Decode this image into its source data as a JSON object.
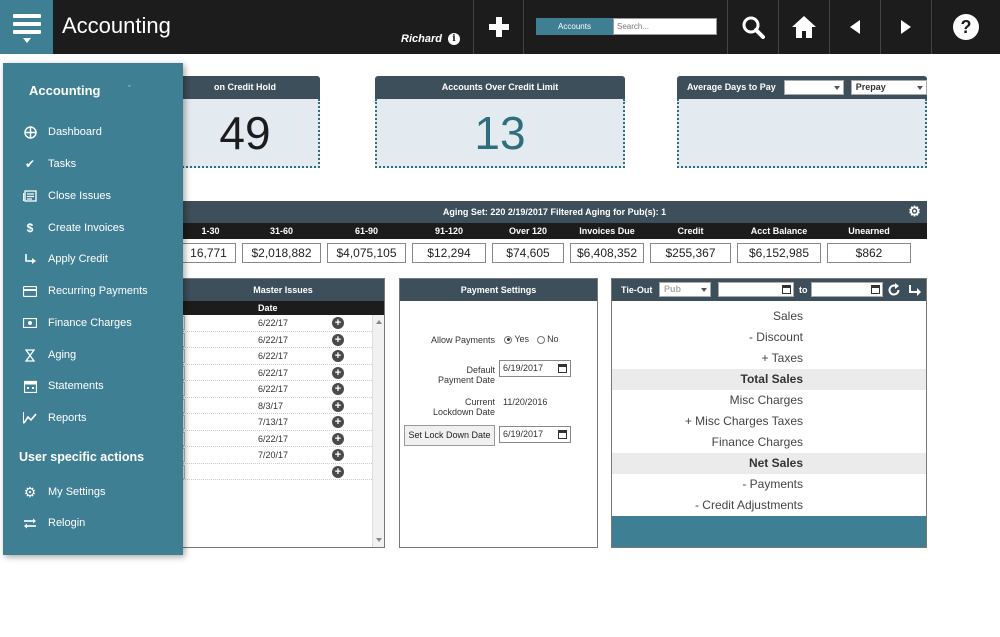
{
  "header": {
    "title": "Accounting",
    "user": "Richard",
    "search_scope": "Accounts",
    "search_placeholder": "Search..."
  },
  "cards": [
    {
      "title": "on Credit Hold",
      "value": "49"
    },
    {
      "title": "Accounts Over Credit Limit",
      "value": "13"
    },
    {
      "title": "Average Days to Pay",
      "select1": "",
      "select2": "Prepay"
    }
  ],
  "aging": {
    "title": "Aging Set:  220 2/19/2017 Filtered Aging for Pub(s): 1",
    "columns": [
      "1-30",
      "31-60",
      "61-90",
      "91-120",
      "Over 120",
      "Invoices Due",
      "Credit",
      "Acct Balance",
      "Unearned"
    ],
    "values": [
      "16,771",
      "$2,018,882",
      "$4,075,105",
      "$12,294",
      "$74,605",
      "$6,408,352",
      "$255,367",
      "$6,152,985",
      "$862"
    ]
  },
  "master_issues": {
    "title": "Master Issues",
    "date_header": "Date",
    "rows": [
      "6/22/17",
      "6/22/17",
      "6/22/17",
      "6/22/17",
      "6/22/17",
      "8/3/17",
      "7/13/17",
      "6/22/17",
      "7/20/17",
      ""
    ]
  },
  "payment_settings": {
    "title": "Payment Settings",
    "allow_payments_label": "Allow Payments",
    "yes_label": "Yes",
    "no_label": "No",
    "default_payment_label_1": "Default",
    "default_payment_label_2": "Payment Date",
    "default_payment_date": "6/19/2017",
    "current_lockdown_label_1": "Current",
    "current_lockdown_label_2": "Lockdown Date",
    "current_lockdown_date": "11/20/2016",
    "set_lock_button": "Set Lock Down Date",
    "set_lock_date": "6/19/2017"
  },
  "tie_out": {
    "title": "Tie-Out",
    "pub_select": "Pub",
    "to_label": "to",
    "rows": [
      {
        "label": "Sales",
        "total": false
      },
      {
        "label": "- Discount",
        "total": false
      },
      {
        "label": "+ Taxes",
        "total": false
      },
      {
        "label": "Total Sales",
        "total": true
      },
      {
        "label": "Misc Charges",
        "total": false
      },
      {
        "label": "+ Misc Charges Taxes",
        "total": false
      },
      {
        "label": "Finance Charges",
        "total": false
      },
      {
        "label": "Net Sales",
        "total": true
      },
      {
        "label": "- Payments",
        "total": false
      },
      {
        "label": "- Credit Adjustments",
        "total": false
      }
    ]
  },
  "side_menu": {
    "title": "Accounting",
    "items": [
      {
        "label": "Dashboard",
        "icon": "crosshair-icon"
      },
      {
        "label": "Tasks",
        "icon": "check-icon"
      },
      {
        "label": "Close Issues",
        "icon": "newspaper-icon"
      },
      {
        "label": "Create Invoices",
        "icon": "dollar-icon"
      },
      {
        "label": "Apply Credit",
        "icon": "arrow-turn-icon"
      },
      {
        "label": "Recurring Payments",
        "icon": "credit-card-icon"
      },
      {
        "label": "Finance Charges",
        "icon": "money-icon"
      },
      {
        "label": "Aging",
        "icon": "hourglass-icon"
      },
      {
        "label": "Statements",
        "icon": "calendar-icon"
      },
      {
        "label": "Reports",
        "icon": "line-chart-icon"
      }
    ],
    "section_title": "User specific actions",
    "user_items": [
      {
        "label": "My Settings",
        "icon": "gear-icon"
      },
      {
        "label": "Relogin",
        "icon": "relogin-icon"
      }
    ]
  }
}
